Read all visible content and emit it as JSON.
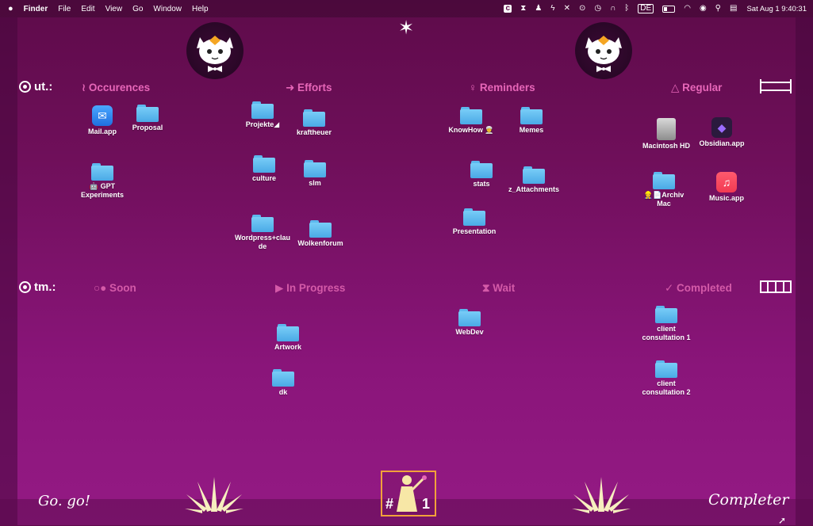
{
  "menubar": {
    "apple": "",
    "app": "Finder",
    "menus": [
      "File",
      "Edit",
      "View",
      "Go",
      "Window",
      "Help"
    ],
    "status_icons": [
      "c-box-icon",
      "hourglass-icon",
      "person-icon",
      "bolt-icon",
      "shuffle-icon",
      "play-circle-icon",
      "history-icon",
      "headphones-icon",
      "bluetooth-icon",
      "input-source-icon",
      "battery-icon",
      "wifi-icon",
      "user-circle-icon",
      "search-icon",
      "control-center-icon"
    ],
    "input_source": "DE",
    "clock": "Sat Aug 1  9:40:31"
  },
  "rows": {
    "top": {
      "label": "ut.:"
    },
    "bottom": {
      "label": "tm.:"
    }
  },
  "headers": {
    "occurences": "≀ Occurences",
    "efforts": "➜ Efforts",
    "reminders": "♀ Reminders",
    "regular": "△ Regular",
    "soon": "○● Soon",
    "in_progress": "▶ In Progress",
    "wait": "⧗ Wait",
    "completed": "✓ Completed"
  },
  "items": {
    "mail": "Mail.app",
    "proposal": "Proposal",
    "gpt": "🤖 GPT\nExperiments",
    "projekte": "Projekte◢",
    "kraftheuer": "kraftheuer",
    "culture": "culture",
    "slm": "slm",
    "wordpress": "Wordpress+clau\nde",
    "wolkenforum": "Wolkenforum",
    "knowhow": "KnowHow 👳",
    "memes": "Memes",
    "stats": "stats",
    "attachments": "z_Attachments",
    "presentation": "Presentation",
    "macintosh": "Macintosh HD",
    "obsidian": "Obsidian.app",
    "archiv": "👷📄Archiv\nMac",
    "music": "Music.app",
    "artwork": "Artwork",
    "dk": "dk",
    "webdev": "WebDev",
    "client1": "client\nconsultation 1",
    "client2": "client\nconsultation 2"
  },
  "bottom": {
    "go": "Go. go!",
    "completer": "Completer",
    "badge_hash": "#",
    "badge_num": "1"
  },
  "colors": {
    "accent_header": "#e766b8",
    "folder": "#5cb8ee",
    "badge_border": "#f2a13a"
  }
}
